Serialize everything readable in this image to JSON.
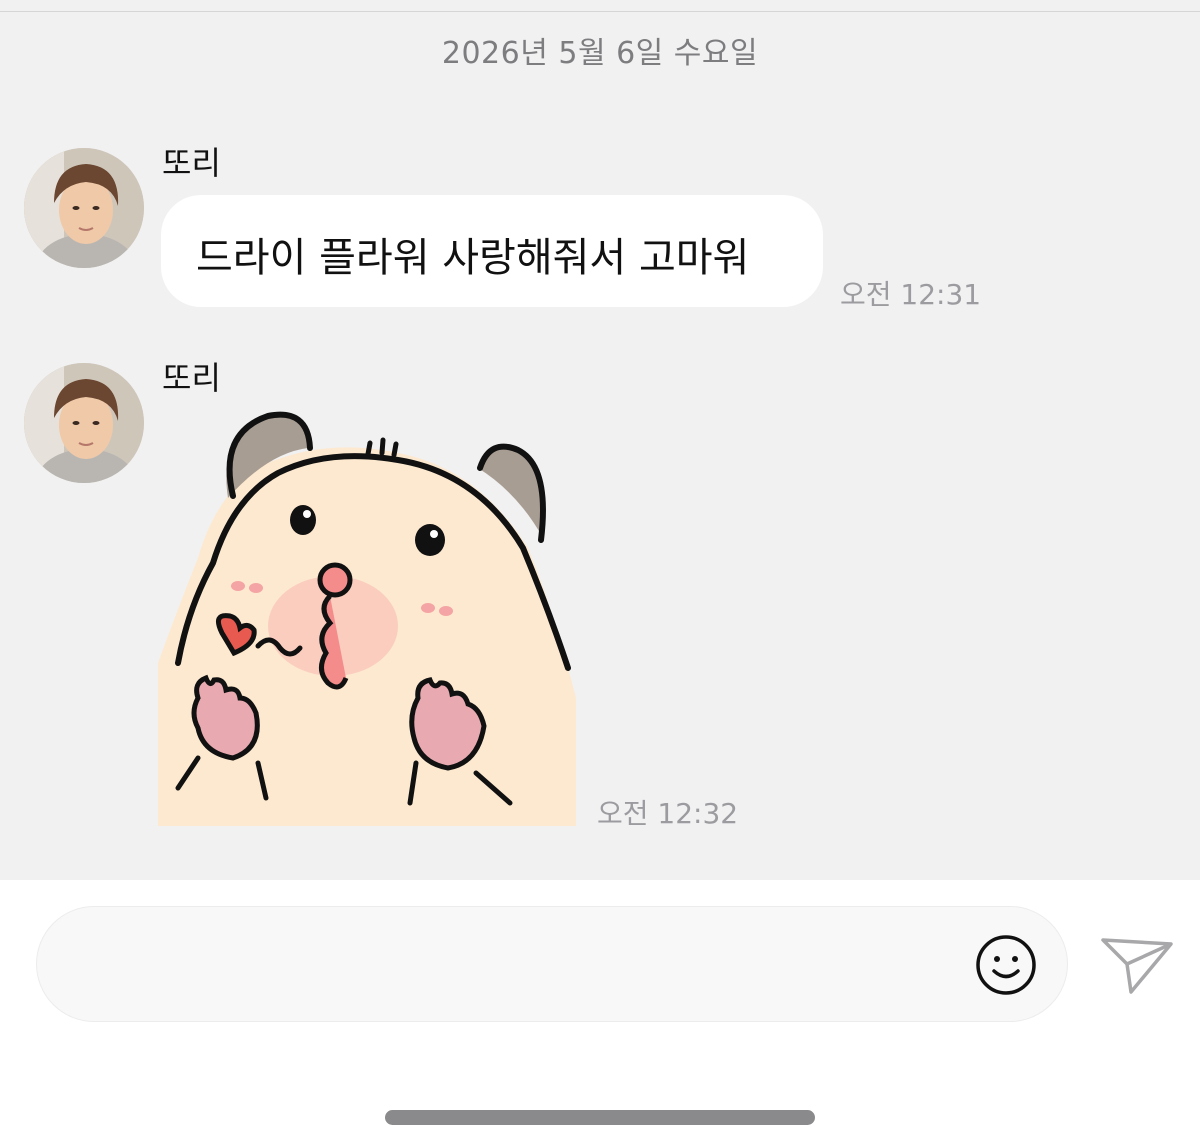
{
  "chat": {
    "date": "2026년 5월 6일 수요일",
    "messages": [
      {
        "sender": "또리",
        "type": "text",
        "text": "드라이 플라워 사랑해줘서 고마워",
        "time": "오전 12:31"
      },
      {
        "sender": "또리",
        "type": "sticker",
        "sticker": "hamster-sticker",
        "time": "오전 12:32"
      }
    ]
  },
  "input": {
    "value": "",
    "placeholder": "",
    "emoji_icon": "smiley-icon",
    "send_icon": "paper-plane-icon"
  },
  "colors": {
    "chat_background": "#f1f1f2",
    "bubble": "#ffffff",
    "sticker_body": "#fde9cf",
    "sticker_ears": "#a89d93"
  }
}
